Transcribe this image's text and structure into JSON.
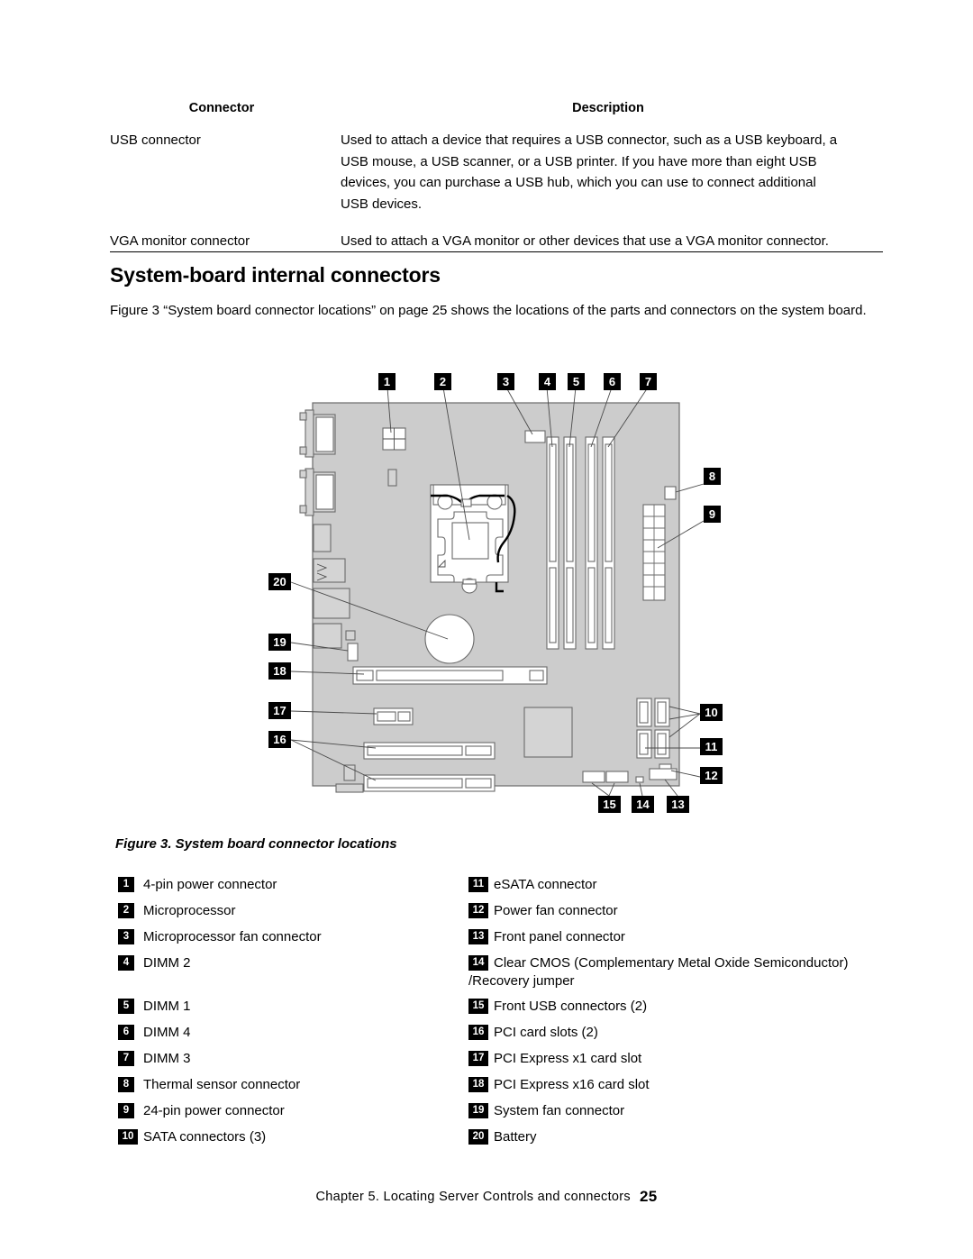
{
  "connector_table": {
    "headers": [
      "Connector",
      "Description"
    ],
    "rows": [
      {
        "connector": "USB connector",
        "description_lines": [
          "Used to attach a device that requires a USB connector, such as a USB keyboard, a",
          "USB mouse, a USB scanner, or a USB printer. If you have more than eight USB",
          "devices, you can purchase a USB hub, which you can use to connect additional",
          "USB devices."
        ]
      },
      {
        "connector": "VGA monitor connector",
        "description_lines": [
          "Used to attach a VGA monitor or other devices that use a VGA monitor connector."
        ]
      }
    ]
  },
  "section": {
    "title": "System-board internal connectors",
    "body": "Figure 3 “System board connector locations” on page 25 shows the locations of the parts and connectors on the system board."
  },
  "figure": {
    "caption": "Figure 3. System board connector locations",
    "callouts": [
      "1",
      "2",
      "3",
      "4",
      "5",
      "6",
      "7",
      "8",
      "9",
      "10",
      "11",
      "12",
      "13",
      "14",
      "15",
      "16",
      "17",
      "18",
      "19",
      "20"
    ]
  },
  "legend": {
    "left": [
      {
        "num": "1",
        "text": "4-pin power connector"
      },
      {
        "num": "2",
        "text": "Microprocessor"
      },
      {
        "num": "3",
        "text": "Microprocessor fan connector"
      },
      {
        "num": "4",
        "text": "DIMM 2"
      },
      {
        "num": "5",
        "text": "DIMM 1"
      },
      {
        "num": "6",
        "text": "DIMM 4"
      },
      {
        "num": "7",
        "text": "DIMM 3"
      },
      {
        "num": "8",
        "text": "Thermal sensor connector"
      },
      {
        "num": "9",
        "text": "24-pin power connector"
      },
      {
        "num": "10",
        "text": "SATA connectors (3)"
      }
    ],
    "right": [
      {
        "num": "11",
        "text": "eSATA connector"
      },
      {
        "num": "12",
        "text": "Power fan connector"
      },
      {
        "num": "13",
        "text": "Front panel connector"
      },
      {
        "num": "14",
        "text": "Clear CMOS (Complementary Metal Oxide Semiconductor)",
        "cont": "/Recovery jumper"
      },
      {
        "num": "15",
        "text": "Front USB connectors (2)"
      },
      {
        "num": "16",
        "text": "PCI card slots (2)"
      },
      {
        "num": "17",
        "text": "PCI Express x1 card slot"
      },
      {
        "num": "18",
        "text": "PCI Express x16 card slot"
      },
      {
        "num": "19",
        "text": "System fan connector"
      },
      {
        "num": "20",
        "text": "Battery"
      }
    ]
  },
  "footer": {
    "chapter": "Chapter 5. Locating Server Controls and connectors",
    "page": "25"
  },
  "colors": {
    "board": "#cccccc",
    "outline": "#555555",
    "component_fill": "#d9d9d9",
    "badge_bg": "#000000",
    "badge_fg": "#ffffff"
  }
}
